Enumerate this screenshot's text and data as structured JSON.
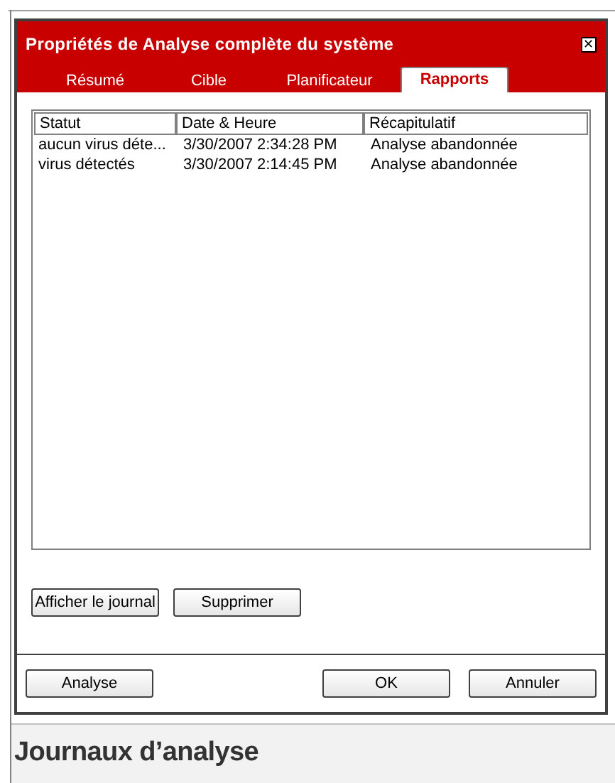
{
  "window": {
    "title": "Propriétés de Analyse complète du système",
    "close": "✕"
  },
  "tabs": [
    {
      "label": "Résumé",
      "selected": false
    },
    {
      "label": "Cible",
      "selected": false
    },
    {
      "label": "Planificateur",
      "selected": false
    },
    {
      "label": "Rapports",
      "selected": true
    }
  ],
  "table": {
    "columns": [
      "Statut",
      "Date & Heure",
      "Récapitulatif"
    ],
    "rows": [
      [
        "aucun virus déte...",
        "3/30/2007 2:34:28 PM",
        "Analyse abandonnée"
      ],
      [
        "virus détectés",
        "3/30/2007 2:14:45 PM",
        "Analyse abandonnée"
      ]
    ]
  },
  "panel_buttons": [
    {
      "label": "Afficher le journal"
    },
    {
      "label": "Supprimer"
    }
  ],
  "dialog_buttons": [
    {
      "label": "Analyse"
    },
    {
      "label": "OK"
    },
    {
      "label": "Annuler"
    }
  ],
  "caption": "Journaux d’analyse"
}
